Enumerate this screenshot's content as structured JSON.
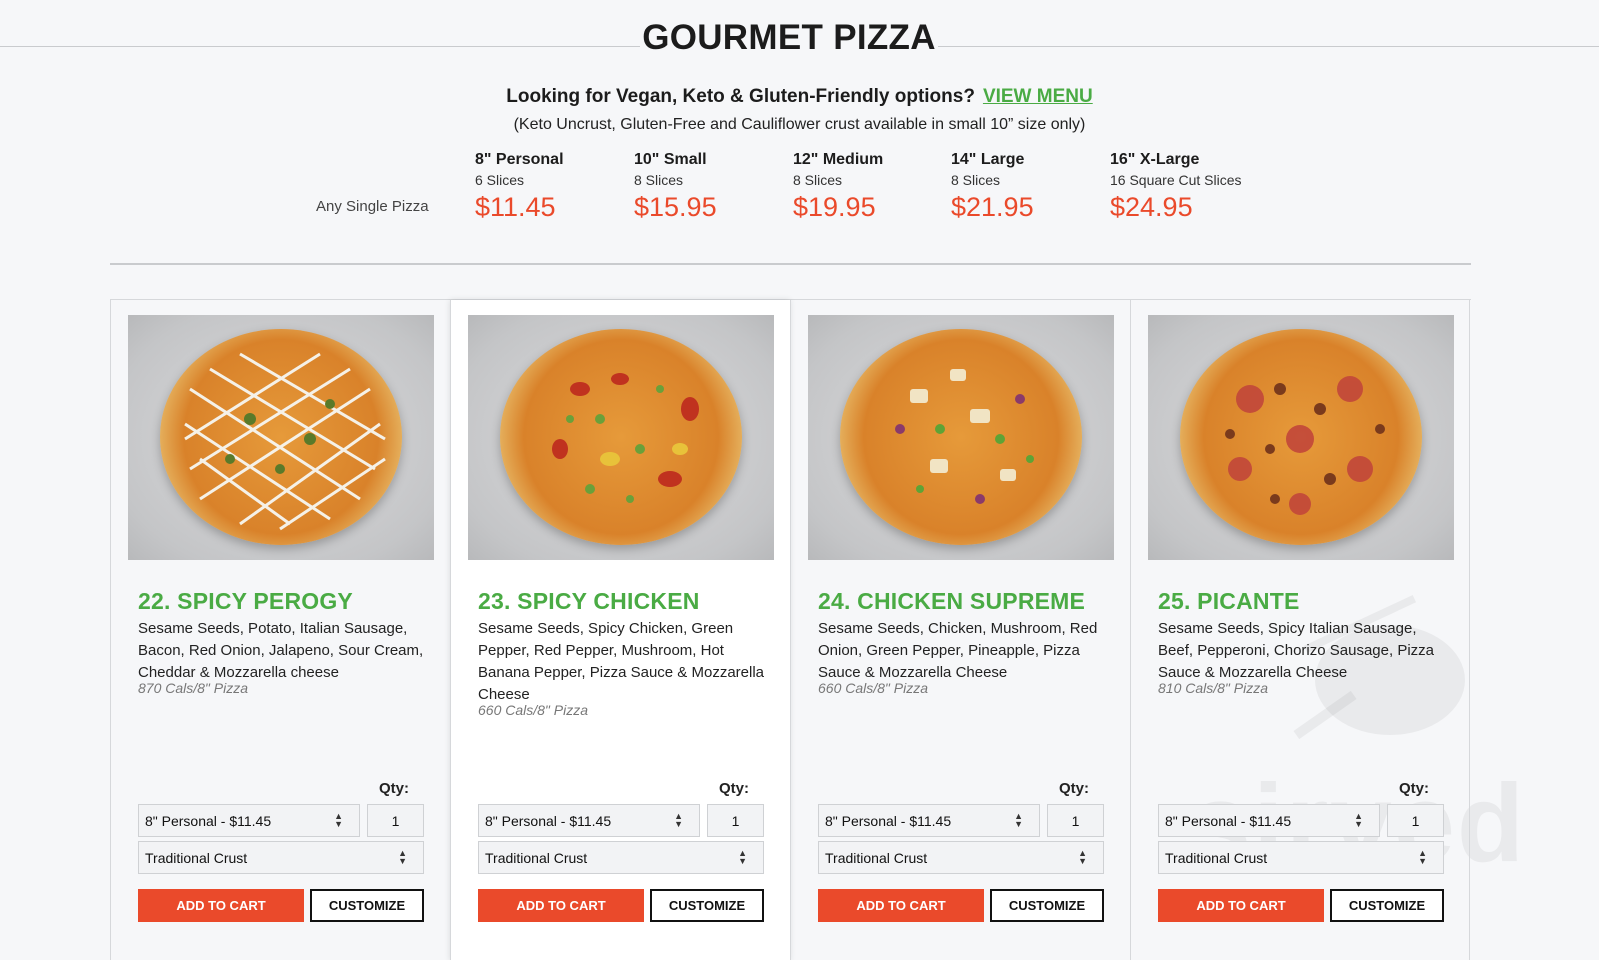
{
  "header": {
    "title": "GOURMET PIZZA",
    "options_text": "Looking for Vegan, Keto & Gluten-Friendly options?",
    "view_menu": "VIEW MENU",
    "crust_note": "(Keto Uncrust, Gluten-Free and Cauliflower crust available in small 10” size only)"
  },
  "pricing": {
    "any_single": "Any Single Pizza",
    "sizes": [
      {
        "name": "8\" Personal",
        "slices": "6 Slices",
        "price": "$11.45"
      },
      {
        "name": "10\" Small",
        "slices": "8 Slices",
        "price": "$15.95"
      },
      {
        "name": "12\" Medium",
        "slices": "8 Slices",
        "price": "$19.95"
      },
      {
        "name": "14\" Large",
        "slices": "8 Slices",
        "price": "$21.95"
      },
      {
        "name": "16\" X-Large",
        "slices": "16 Square Cut Slices",
        "price": "$24.95"
      }
    ]
  },
  "products": [
    {
      "name": "22. SPICY PEROGY",
      "description": "Sesame Seeds, Potato, Italian Sausage, Bacon, Red Onion, Jalapeno, Sour Cream, Cheddar & Mozzarella cheese",
      "cals": "870 Cals/8\" Pizza",
      "qty_label": "Qty:",
      "size_select": "8\" Personal - $11.45",
      "qty": "1",
      "crust_select": "Traditional Crust",
      "add_to_cart": "ADD TO CART",
      "customize": "CUSTOMIZE"
    },
    {
      "name": "23. SPICY CHICKEN",
      "description": "Sesame Seeds, Spicy Chicken, Green Pepper, Red Pepper, Mushroom, Hot Banana Pepper, Pizza Sauce & Mozzarella Cheese",
      "cals": "660 Cals/8\" Pizza",
      "qty_label": "Qty:",
      "size_select": "8\" Personal - $11.45",
      "qty": "1",
      "crust_select": "Traditional Crust",
      "add_to_cart": "ADD TO CART",
      "customize": "CUSTOMIZE"
    },
    {
      "name": "24. CHICKEN SUPREME",
      "description": "Sesame Seeds, Chicken, Mushroom, Red Onion, Green Pepper, Pineapple, Pizza Sauce & Mozzarella Cheese",
      "cals": "660 Cals/8\" Pizza",
      "qty_label": "Qty:",
      "size_select": "8\" Personal - $11.45",
      "qty": "1",
      "crust_select": "Traditional Crust",
      "add_to_cart": "ADD TO CART",
      "customize": "CUSTOMIZE"
    },
    {
      "name": "25. PICANTE",
      "description": "Sesame Seeds, Spicy Italian Sausage, Beef, Pepperoni, Chorizo Sausage, Pizza Sauce & Mozzarella Cheese",
      "cals": "810 Cals/8\" Pizza",
      "qty_label": "Qty:",
      "size_select": "8\" Personal - $11.45",
      "qty": "1",
      "crust_select": "Traditional Crust",
      "add_to_cart": "ADD TO CART",
      "customize": "CUSTOMIZE"
    }
  ],
  "watermark": "sirved",
  "colors": {
    "accent_green": "#4aab44",
    "price_red": "#ea4a2b",
    "button_red": "#ea4a2b"
  }
}
